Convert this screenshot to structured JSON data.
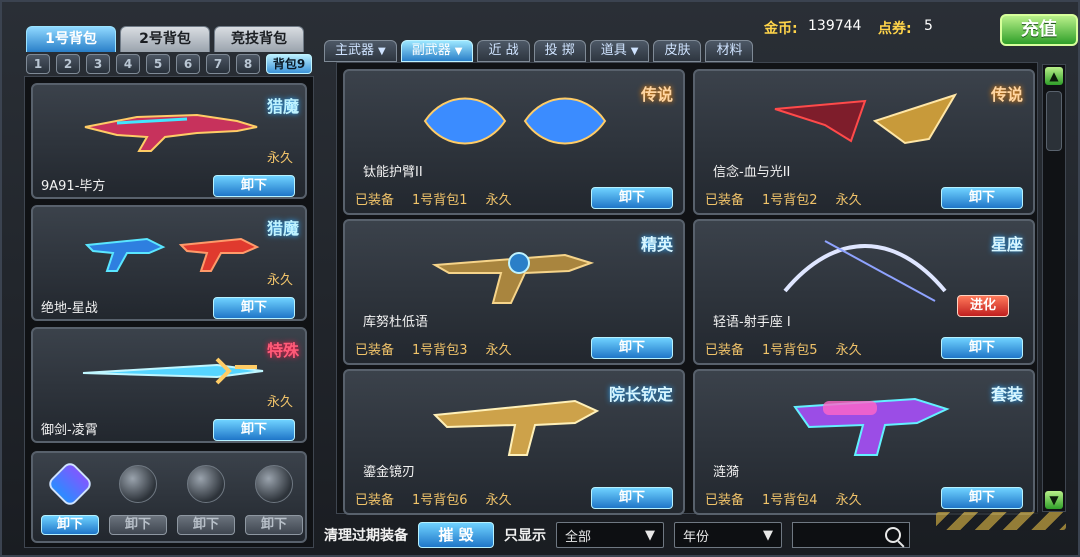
{
  "header": {
    "gold_label": "金币:",
    "gold_value": "139744",
    "point_label": "点券:",
    "point_value": "5",
    "recharge_label": "充值"
  },
  "bag_tabs": [
    {
      "label": "1号背包",
      "active": true
    },
    {
      "label": "2号背包",
      "active": false
    },
    {
      "label": "竞技背包",
      "active": false
    }
  ],
  "num_tabs": [
    {
      "label": "1"
    },
    {
      "label": "2"
    },
    {
      "label": "3"
    },
    {
      "label": "4"
    },
    {
      "label": "5"
    },
    {
      "label": "6"
    },
    {
      "label": "7"
    },
    {
      "label": "8"
    },
    {
      "label": "背包9",
      "active": true
    }
  ],
  "left_items": [
    {
      "name": "9A91-毕方",
      "badge": "猎魔",
      "duration": "永久",
      "button": "卸下"
    },
    {
      "name": "绝地-星战",
      "badge": "猎魔",
      "duration": "永久",
      "button": "卸下"
    },
    {
      "name": "御剑-凌霄",
      "badge": "特殊",
      "duration": "永久",
      "button": "卸下"
    }
  ],
  "mini_slots": [
    {
      "button": "卸下",
      "active": true
    },
    {
      "button": "卸下",
      "active": false
    },
    {
      "button": "卸下",
      "active": false
    },
    {
      "button": "卸下",
      "active": false
    }
  ],
  "category_tabs": [
    {
      "label": "主武器",
      "has_caret": true,
      "active": false
    },
    {
      "label": "副武器",
      "has_caret": true,
      "active": true
    },
    {
      "label": "近 战",
      "has_caret": false,
      "active": false
    },
    {
      "label": "投 掷",
      "has_caret": false,
      "active": false
    },
    {
      "label": "道具",
      "has_caret": true,
      "active": false
    },
    {
      "label": "皮肤",
      "has_caret": false,
      "active": false
    },
    {
      "label": "材料",
      "has_caret": false,
      "active": false
    }
  ],
  "cards": [
    {
      "name": "钛能护臂II",
      "badge": "传说",
      "status": "已装备",
      "bag": "1号背包1",
      "duration": "永久",
      "button": "卸下"
    },
    {
      "name": "信念-血与光II",
      "badge": "传说",
      "status": "已装备",
      "bag": "1号背包2",
      "duration": "永久",
      "button": "卸下"
    },
    {
      "name": "库努杜低语",
      "badge": "精英",
      "status": "已装备",
      "bag": "1号背包3",
      "duration": "永久",
      "button": "卸下"
    },
    {
      "name": "轻语-射手座 I",
      "badge": "星座",
      "evolve": "进化",
      "status": "已装备",
      "bag": "1号背包5",
      "duration": "永久",
      "button": "卸下"
    },
    {
      "name": "鎏金镜刃",
      "badge": "院长钦定",
      "status": "已装备",
      "bag": "1号背包6",
      "duration": "永久",
      "button": "卸下"
    },
    {
      "name": "涟漪",
      "badge": "套装",
      "status": "已装备",
      "bag": "1号背包4",
      "duration": "永久",
      "button": "卸下"
    }
  ],
  "bottom": {
    "clear_label": "清理过期装备",
    "destroy_label": "摧 毁",
    "only_show_label": "只显示",
    "filter_all": "全部",
    "filter_year": "年份",
    "search_placeholder": ""
  },
  "scroll": {
    "up": "▲",
    "down": "▼"
  },
  "icons": {
    "caret": "▼",
    "search": "search-icon"
  }
}
